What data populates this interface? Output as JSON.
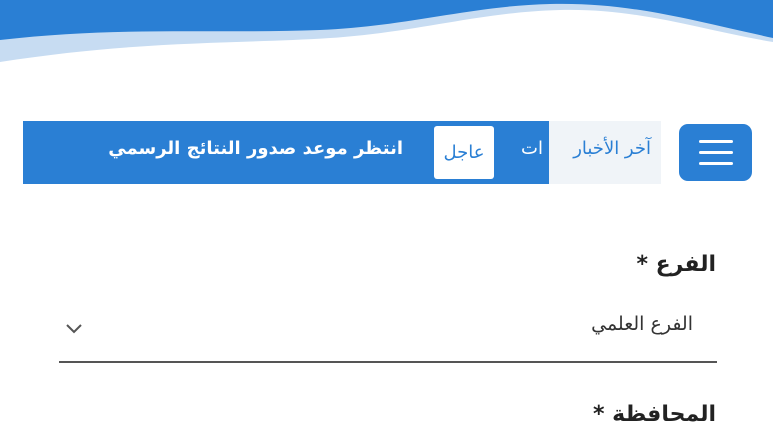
{
  "header": {
    "menu_icon": "hamburger-menu-icon",
    "accent_color": "#2a7fd4"
  },
  "news_ticker": {
    "label": "آخر الأخبار",
    "label_tail": "ات",
    "breaking_badge": "عاجل",
    "headline": "انتظر موعد صدور النتائج الرسمي"
  },
  "form": {
    "branch": {
      "label": "الفرع *",
      "selected_value": "الفرع العلمي",
      "dropdown_icon": "chevron-down-icon"
    },
    "governorate": {
      "label": "المحافظة *"
    }
  }
}
